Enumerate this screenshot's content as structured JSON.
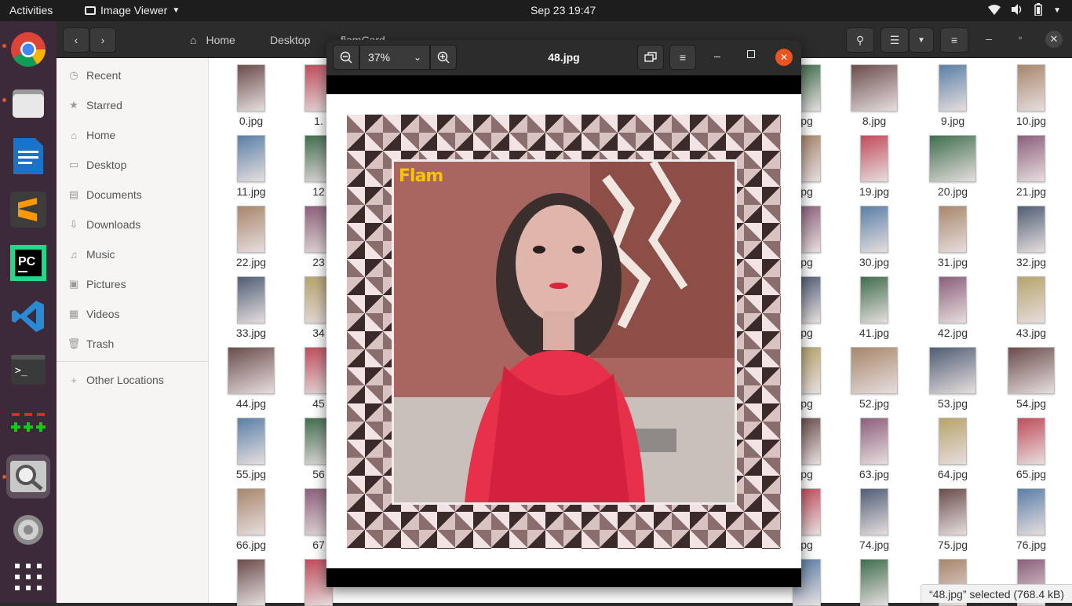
{
  "topbar": {
    "activities": "Activities",
    "app_name": "Image Viewer",
    "clock": "Sep 23  19:47"
  },
  "file_manager": {
    "breadcrumbs": [
      "Home",
      "Desktop",
      "flamCard"
    ],
    "sidebar": [
      {
        "label": "Recent",
        "icon": "clock-icon"
      },
      {
        "label": "Starred",
        "icon": "star-icon"
      },
      {
        "label": "Home",
        "icon": "home-icon"
      },
      {
        "label": "Desktop",
        "icon": "desktop-icon"
      },
      {
        "label": "Documents",
        "icon": "document-icon"
      },
      {
        "label": "Downloads",
        "icon": "download-icon"
      },
      {
        "label": "Music",
        "icon": "music-icon"
      },
      {
        "label": "Pictures",
        "icon": "picture-icon"
      },
      {
        "label": "Videos",
        "icon": "video-icon"
      },
      {
        "label": "Trash",
        "icon": "trash-icon"
      }
    ],
    "other_locations": "Other Locations",
    "files_left": [
      "0.jpg",
      "1.",
      "11.jpg",
      "12",
      "22.jpg",
      "23",
      "33.jpg",
      "34",
      "44.jpg",
      "45",
      "55.jpg",
      "56",
      "66.jpg",
      "67"
    ],
    "files_mid": [
      "pg",
      "pg",
      "pg",
      "pg",
      "pg",
      "pg",
      "pg"
    ],
    "files_right_a": [
      "8.jpg",
      "19.jpg",
      "30.jpg",
      "41.jpg",
      "52.jpg",
      "63.jpg",
      "74.jpg"
    ],
    "files_right_b": [
      "9.jpg",
      "20.jpg",
      "31.jpg",
      "42.jpg",
      "53.jpg",
      "64.jpg",
      "75.jpg"
    ],
    "files_right_c": [
      "10.jpg",
      "21.jpg",
      "32.jpg",
      "43.jpg",
      "54.jpg",
      "65.jpg",
      "76.jpg"
    ],
    "status": "“48.jpg” selected  (768.4 kB)"
  },
  "viewer": {
    "zoom": "37%",
    "title": "48.jpg",
    "logo_text": "Flam"
  },
  "colors": {
    "accent": "#e95420",
    "close": "#e95420",
    "dock_bg": "#3c2a3a"
  }
}
